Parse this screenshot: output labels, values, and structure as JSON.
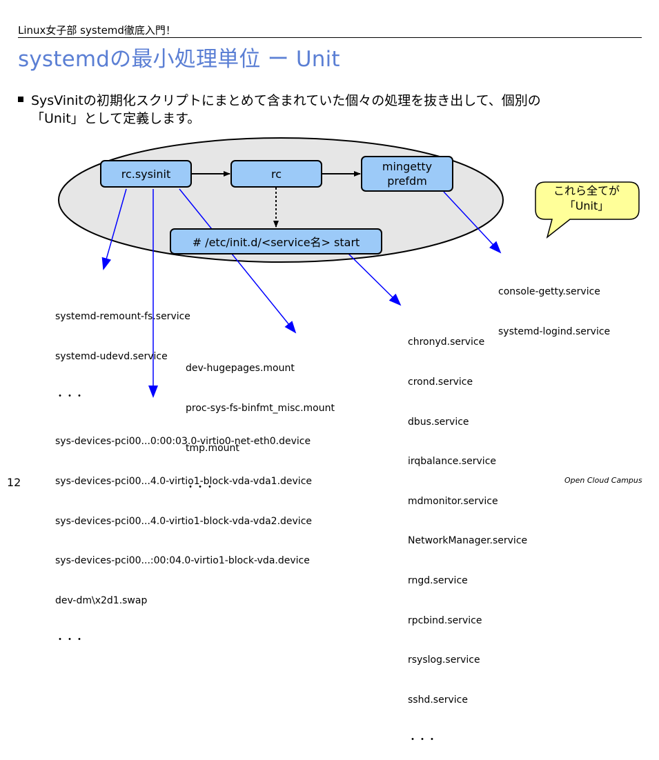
{
  "header": {
    "label": "Linux女子部 systemd徹底入門！"
  },
  "title": "systemdの最小処理単位 ー Unit",
  "bullet": {
    "line1": "SysVinitの初期化スクリプトにまとめて含まれていた個々の処理を抜き出して、個別の",
    "line2": "「Unit」として定義します。"
  },
  "diagram": {
    "nodes": {
      "rc_sysinit": "rc.sysinit",
      "rc": "rc",
      "mingetty_line1": "mingetty",
      "mingetty_line2": "prefdm",
      "initd": "# /etc/init.d/<service名> start"
    },
    "callout": {
      "line1": "これら全てが",
      "line2": "「Unit」"
    },
    "lists": {
      "remount": [
        "systemd-remount-fs.service",
        "systemd-udevd.service",
        "・・・"
      ],
      "mounts": [
        "dev-hugepages.mount",
        "proc-sys-fs-binfmt_misc.mount",
        "tmp.mount",
        "・・・"
      ],
      "devices": [
        "sys-devices-pci00...0:00:03.0-virtio0-net-eth0.device",
        "sys-devices-pci00...4.0-virtio1-block-vda-vda1.device",
        "sys-devices-pci00...4.0-virtio1-block-vda-vda2.device",
        "sys-devices-pci00...:00:04.0-virtio1-block-vda.device",
        "dev-dm\\x2d1.swap",
        "・・・"
      ],
      "console": [
        "console-getty.service",
        "systemd-logind.service"
      ],
      "services": [
        "chronyd.service",
        "crond.service",
        "dbus.service",
        "irqbalance.service",
        "mdmonitor.service",
        "NetworkManager.service",
        "rngd.service",
        "rpcbind.service",
        "rsyslog.service",
        "sshd.service",
        "・・・"
      ]
    },
    "colors": {
      "box_fill": "#9ccaf8",
      "ellipse_fill": "#e6e6e6",
      "callout_fill": "#ffff99",
      "arrow_blue": "#0000ff",
      "title_blue": "#5b7fd4"
    }
  },
  "footer": {
    "page": "12",
    "brand": "Open Cloud Campus"
  }
}
